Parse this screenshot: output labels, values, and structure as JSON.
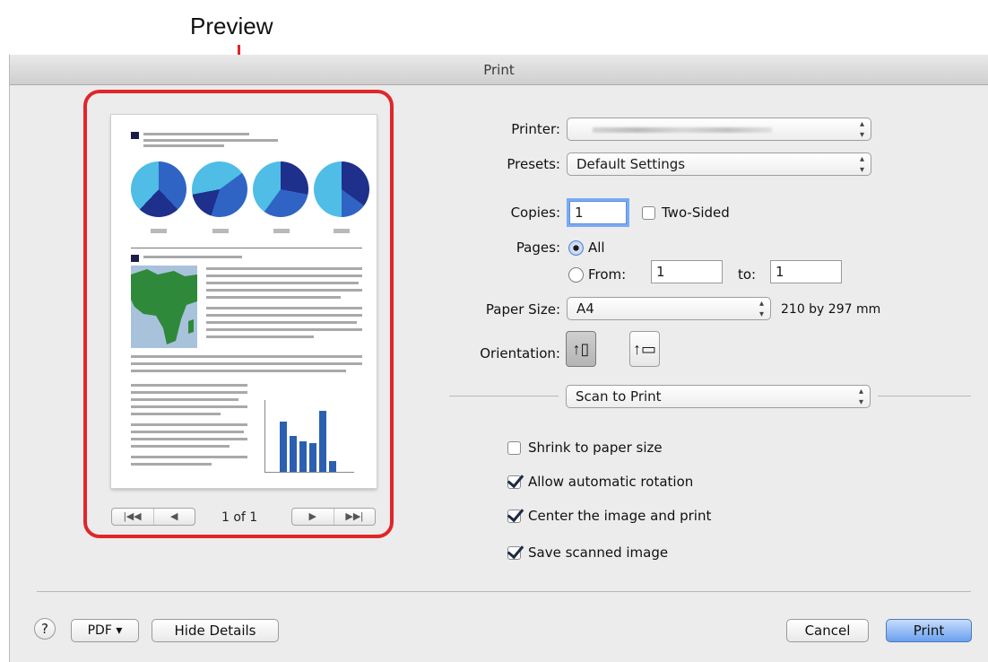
{
  "callout": {
    "label": "Preview"
  },
  "window": {
    "title": "Print"
  },
  "preview": {
    "page_count": "1 of 1",
    "nav_first": "|◀◀",
    "nav_prev": "◀",
    "nav_next": "▶",
    "nav_last": "▶▶|"
  },
  "printer": {
    "label": "Printer:",
    "value": ""
  },
  "presets": {
    "label": "Presets:",
    "value": "Default Settings"
  },
  "copies": {
    "label": "Copies:",
    "value": "1",
    "two_sided_label": "Two-Sided",
    "two_sided_checked": false
  },
  "pages": {
    "label": "Pages:",
    "all_label": "All",
    "from_label": "From:",
    "from_value": "1",
    "to_label": "to:",
    "to_value": "1",
    "selected": "All"
  },
  "paper_size": {
    "label": "Paper Size:",
    "value": "A4",
    "dimensions": "210 by 297 mm"
  },
  "orientation": {
    "label": "Orientation:",
    "selected": "portrait"
  },
  "section": {
    "value": "Scan to Print"
  },
  "options": [
    {
      "label": "Shrink to paper size",
      "checked": false
    },
    {
      "label": "Allow automatic rotation",
      "checked": true
    },
    {
      "label": "Center the image and print",
      "checked": true
    },
    {
      "label": "Save scanned image",
      "checked": true
    }
  ],
  "footer": {
    "help": "?",
    "pdf_label": "PDF ▾",
    "hide_details": "Hide Details",
    "cancel": "Cancel",
    "print": "Print"
  },
  "colors": {
    "highlight": "#e0262b",
    "pie_light": "#4fbde6",
    "pie_mid": "#2f64c4",
    "pie_dark": "#1e2f8c",
    "map_land": "#2e8a3a",
    "chart_bar": "#2c5fb2"
  }
}
